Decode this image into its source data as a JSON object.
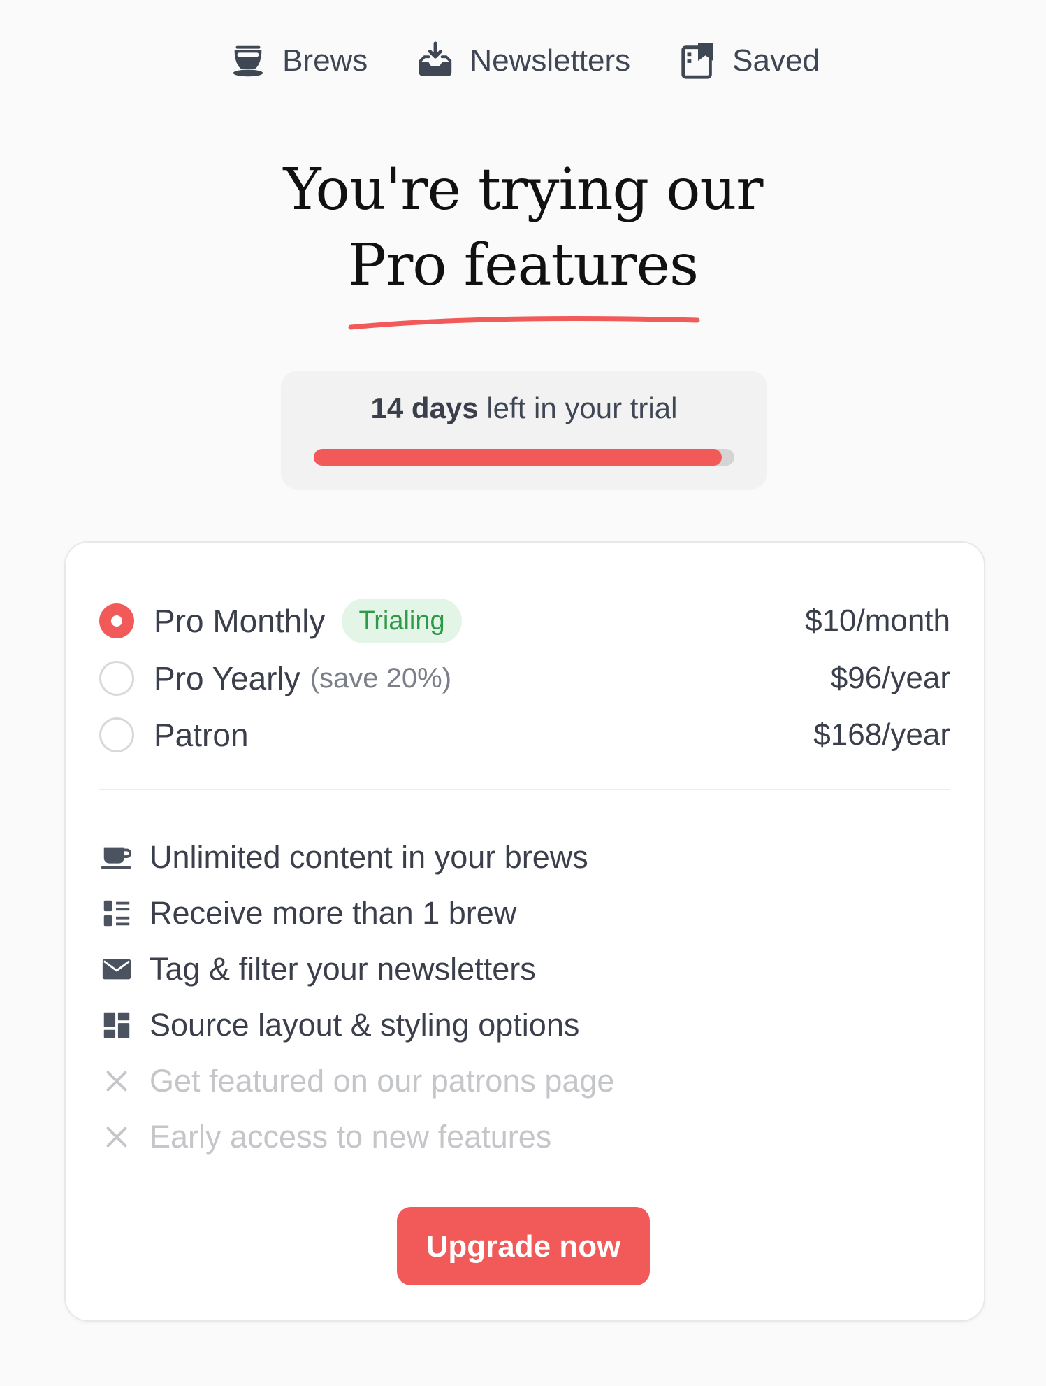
{
  "nav": {
    "items": [
      {
        "label": "Brews",
        "icon": "teacup-icon"
      },
      {
        "label": "Newsletters",
        "icon": "inbox-download-icon"
      },
      {
        "label": "Saved",
        "icon": "bookmark-note-icon"
      }
    ]
  },
  "headline": {
    "line1": "You're trying our",
    "line2": "Pro features"
  },
  "trial": {
    "days": "14 days",
    "suffix": " left in your trial",
    "progress_percent": 97
  },
  "plans": [
    {
      "name": "Pro Monthly",
      "badge": "Trialing",
      "note": "",
      "price": "$10/month",
      "selected": true
    },
    {
      "name": "Pro Yearly",
      "badge": "",
      "note": "(save 20%)",
      "price": "$96/year",
      "selected": false
    },
    {
      "name": "Patron",
      "badge": "",
      "note": "",
      "price": "$168/year",
      "selected": false
    }
  ],
  "features": [
    {
      "text": "Unlimited content in your brews",
      "icon": "coffee-cup-icon",
      "included": true
    },
    {
      "text": "Receive more than 1 brew",
      "icon": "list-icon",
      "included": true
    },
    {
      "text": "Tag & filter your newsletters",
      "icon": "envelope-icon",
      "included": true
    },
    {
      "text": "Source layout & styling options",
      "icon": "layout-icon",
      "included": true
    },
    {
      "text": "Get featured on our patrons page",
      "icon": "x-icon",
      "included": false
    },
    {
      "text": "Early access to new features",
      "icon": "x-icon",
      "included": false
    }
  ],
  "cta": {
    "label": "Upgrade now"
  },
  "colors": {
    "accent": "#f25a5a",
    "badge_bg": "#e3f5e7",
    "badge_text": "#2e9a48"
  }
}
